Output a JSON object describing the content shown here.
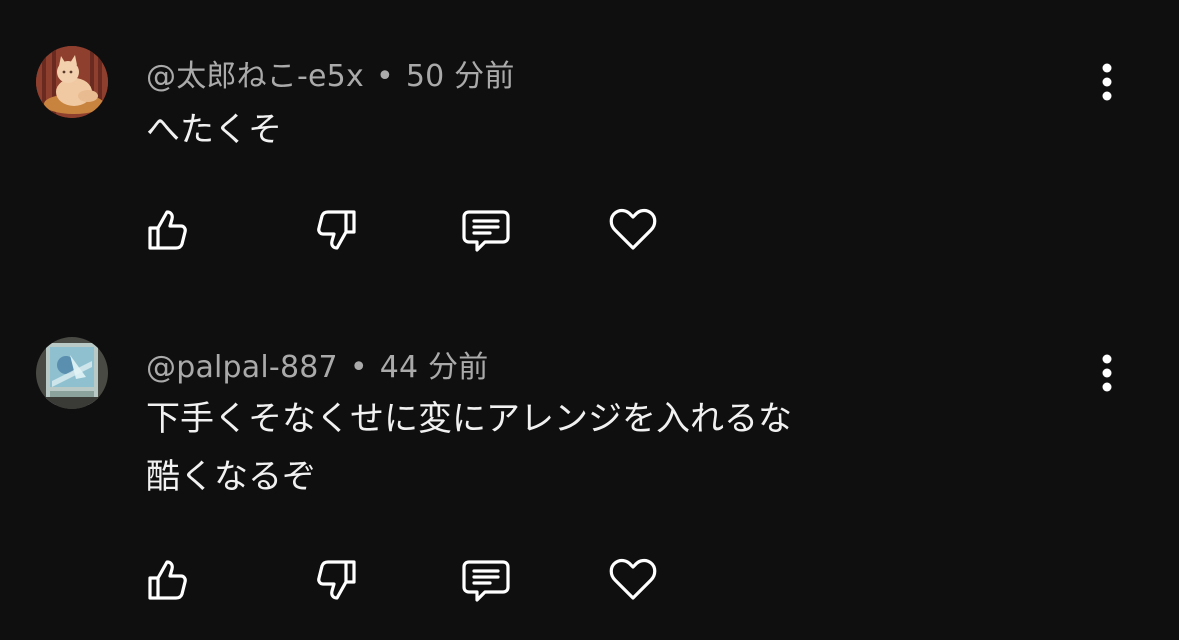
{
  "comments": [
    {
      "author": "@太郎ねこ-e5x",
      "separator": "•",
      "time": "50 分前",
      "lines": [
        "へたくそ"
      ],
      "avatar": {
        "icon": "cat-photo-avatar",
        "bg": "#8a3b2c"
      }
    },
    {
      "author": "@palpal-887",
      "separator": "•",
      "time": "44 分前",
      "lines": [
        "下手くそなくせに変にアレンジを入れるな",
        "酷くなるぞ"
      ],
      "avatar": {
        "icon": "card-art-avatar",
        "bg": "#6a7a78"
      }
    }
  ],
  "icons": {
    "like": "thumbs-up-icon",
    "dislike": "thumbs-down-icon",
    "reply": "reply-icon",
    "heart": "heart-icon",
    "more": "more-vert-icon"
  },
  "colors": {
    "background": "#0f0f0f",
    "text": "#f1f1f1",
    "meta": "#aaaaaa",
    "icon": "#ffffff"
  }
}
